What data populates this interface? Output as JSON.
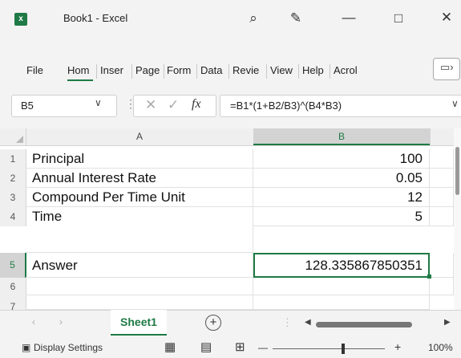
{
  "window": {
    "app_badge": "x",
    "title": "Book1  -  Excel",
    "icons": [
      "search-icon",
      "copilot-icon",
      "minimize-icon",
      "maximize-icon",
      "close-icon"
    ]
  },
  "ribbon": {
    "tabs": [
      "File",
      "Hom",
      "Inser",
      "Page",
      "Form",
      "Data",
      "Revie",
      "View",
      "Help",
      "Acrol"
    ],
    "active_tab": "Hom"
  },
  "formula_bar": {
    "name_box": "B5",
    "fx": "fx",
    "formula": "=B1*(1+B2/B3)^(B4*B3)"
  },
  "grid": {
    "columns": [
      "A",
      "B"
    ],
    "active_column": "B",
    "rows": [
      {
        "num": "1",
        "a": "Principal",
        "b": "100"
      },
      {
        "num": "2",
        "a": "Annual Interest Rate",
        "b": "0.05"
      },
      {
        "num": "3",
        "a": "Compound Per Time Unit",
        "b": "12"
      },
      {
        "num": "4",
        "a": "Time",
        "b": "5"
      },
      {
        "num": "5",
        "a": "Answer",
        "b": "128.335867850351"
      },
      {
        "num": "6",
        "a": "",
        "b": ""
      },
      {
        "num": "7",
        "a": "",
        "b": ""
      }
    ],
    "active_row": "5"
  },
  "sheets": {
    "tabs": [
      "Sheet1"
    ],
    "add": "+"
  },
  "status": {
    "display_settings": "Display Settings",
    "zoom_out": "—",
    "zoom_in": "+",
    "zoom": "100%"
  },
  "colors": {
    "accent": "#1f7a45"
  }
}
